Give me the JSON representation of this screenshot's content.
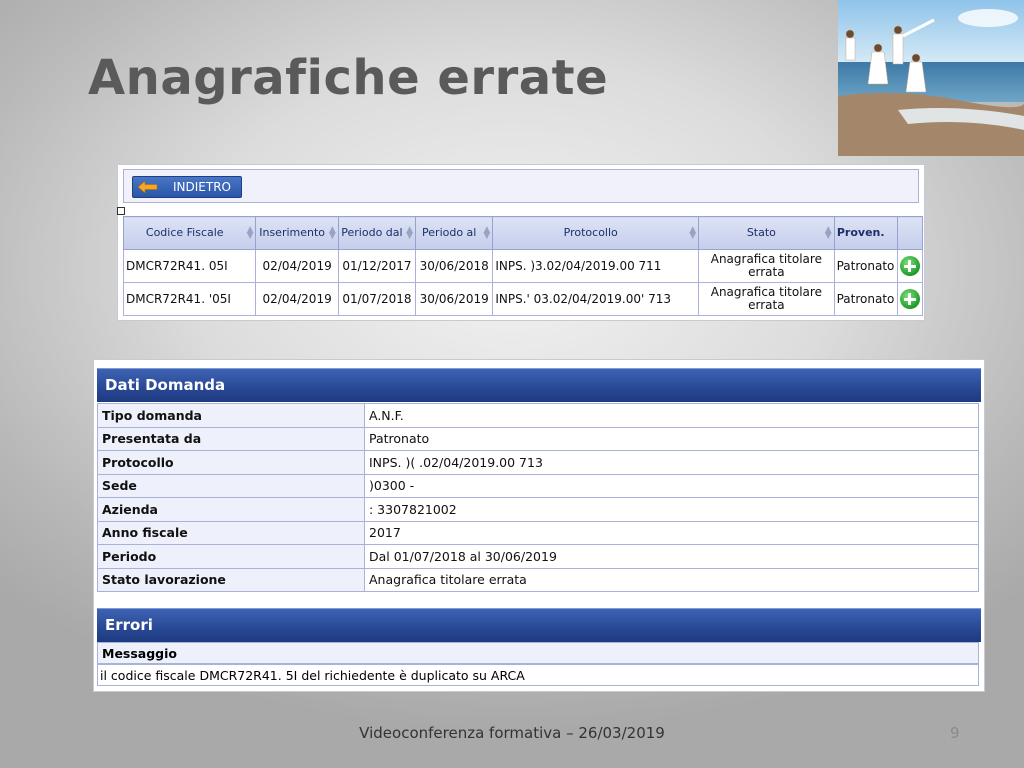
{
  "slide": {
    "title": "Anagrafiche errate",
    "footer": "Videoconferenza formativa – 26/03/2019",
    "page_number": "9"
  },
  "grid": {
    "back_button_label": "INDIETRO",
    "columns": [
      "Codice Fiscale",
      "Inserimento",
      "Periodo dal",
      "Periodo al",
      "Protocollo",
      "Stato",
      "Proven.",
      ""
    ],
    "rows": [
      {
        "codice_fiscale": "DMCR72R41.   05I",
        "inserimento": "02/04/2019",
        "periodo_dal": "01/12/2017",
        "periodo_al": "30/06/2018",
        "protocollo": "INPS.      )3.02/04/2019.00      711",
        "stato": "Anagrafica titolare errata",
        "proven": "Patronato",
        "action_icon": "plus-circle-icon"
      },
      {
        "codice_fiscale": "DMCR72R41.   '05I",
        "inserimento": "02/04/2019",
        "periodo_dal": "01/07/2018",
        "periodo_al": "30/06/2019",
        "protocollo": "INPS.'         03.02/04/2019.00'     713",
        "stato": "Anagrafica titolare errata",
        "proven": "Patronato",
        "action_icon": "plus-circle-icon"
      }
    ]
  },
  "dati_domanda": {
    "heading": "Dati Domanda",
    "fields": [
      {
        "label": "Tipo domanda",
        "value": "A.N.F."
      },
      {
        "label": "Presentata da",
        "value": "Patronato"
      },
      {
        "label": "Protocollo",
        "value": "INPS.  )(   .02/04/2019.00     713"
      },
      {
        "label": "Sede",
        "value": "  )0300 -"
      },
      {
        "label": "Azienda",
        "value": ": 3307821002"
      },
      {
        "label": "Anno fiscale",
        "value": "2017"
      },
      {
        "label": "Periodo",
        "value": "Dal 01/07/2018 al 30/06/2019"
      },
      {
        "label": "Stato lavorazione",
        "value": "Anagrafica titolare errata"
      }
    ]
  },
  "errori": {
    "heading": "Errori",
    "message_label": "Messaggio",
    "message": "il codice fiscale       DMCR72R41.  5I del richiedente è duplicato su ARCA"
  },
  "colors": {
    "title_gray": "#5a5a5a",
    "section_blue": "#2a4a96",
    "add_green": "#1f9a2a"
  }
}
